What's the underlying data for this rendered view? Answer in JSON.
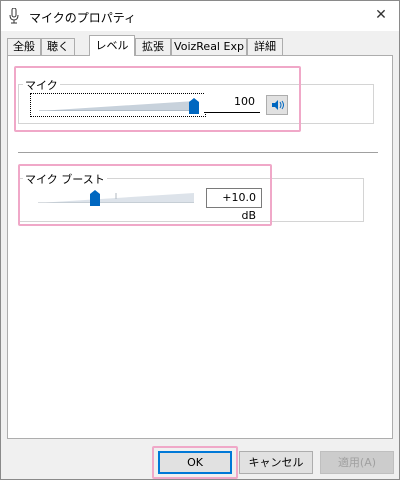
{
  "window": {
    "title": "マイクのプロパティ",
    "close_glyph": "✕"
  },
  "tabs": [
    {
      "label": "全般",
      "active": false
    },
    {
      "label": "聴く",
      "active": false
    },
    {
      "label": "レベル",
      "active": true
    },
    {
      "label": "拡張",
      "active": false
    },
    {
      "label": "VoizReal Exp",
      "active": false
    },
    {
      "label": "詳細",
      "active": false
    }
  ],
  "mic_level": {
    "label": "マイク",
    "value": "100",
    "level": 100,
    "speaker_icon": "speaker-icon"
  },
  "mic_boost": {
    "label": "マイク ブースト",
    "value": "+10.0 dB",
    "level_fraction": 0.33
  },
  "buttons": {
    "ok": "OK",
    "cancel": "キャンセル",
    "apply": "適用(A)"
  },
  "colors": {
    "highlight": "#f0a8c8",
    "accent": "#0078d7",
    "thumb": "#0067c0"
  }
}
